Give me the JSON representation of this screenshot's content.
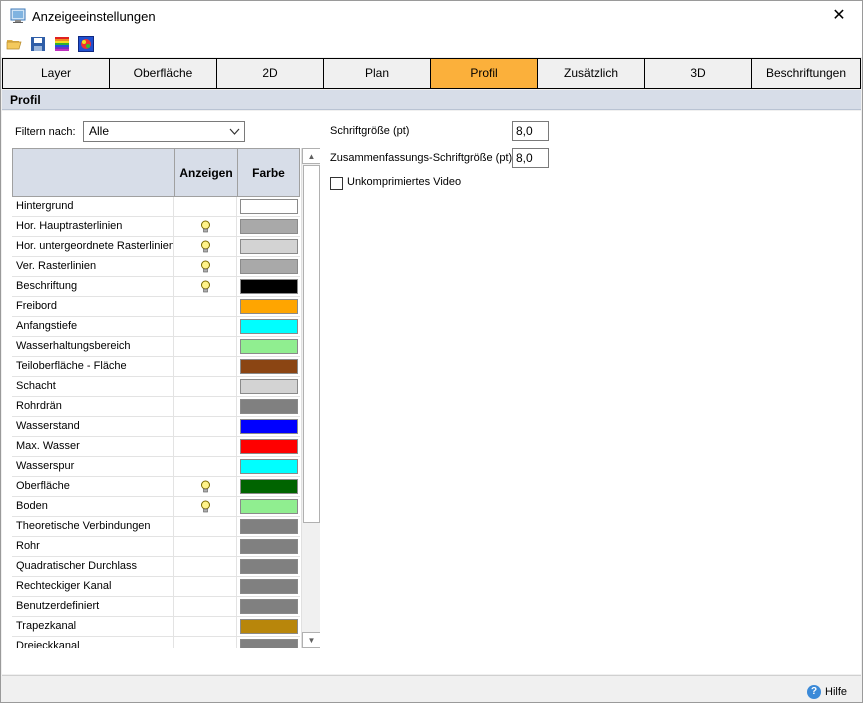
{
  "window": {
    "title": "Anzeigeeinstellungen",
    "close_glyph": "✕"
  },
  "toolbar": {
    "icons": [
      "open-folder-icon",
      "save-icon",
      "color-bars-icon",
      "color-palette-icon"
    ]
  },
  "tabs": [
    {
      "label": "Layer",
      "active": false
    },
    {
      "label": "Oberfläche",
      "active": false
    },
    {
      "label": "2D",
      "active": false
    },
    {
      "label": "Plan",
      "active": false
    },
    {
      "label": "Profil",
      "active": true
    },
    {
      "label": "Zusätzlich",
      "active": false
    },
    {
      "label": "3D",
      "active": false
    },
    {
      "label": "Beschriftungen",
      "active": false
    }
  ],
  "section": {
    "title": "Profil"
  },
  "filter": {
    "label": "Filtern nach:",
    "value": "Alle"
  },
  "grid": {
    "headers": {
      "show": "Anzeigen",
      "color": "Farbe"
    },
    "rows": [
      {
        "name": "Hintergrund",
        "show": false,
        "color": "#ffffff"
      },
      {
        "name": "Hor. Hauptrasterlinien",
        "show": true,
        "color": "#a9a9a9"
      },
      {
        "name": "Hor. untergeordnete Rasterlinien",
        "show": true,
        "color": "#d3d3d3"
      },
      {
        "name": "Ver. Rasterlinien",
        "show": true,
        "color": "#a9a9a9"
      },
      {
        "name": "Beschriftung",
        "show": true,
        "color": "#000000"
      },
      {
        "name": "Freibord",
        "show": false,
        "color": "#ffa500"
      },
      {
        "name": "Anfangstiefe",
        "show": false,
        "color": "#00ffff"
      },
      {
        "name": "Wasserhaltungsbereich",
        "show": false,
        "color": "#90ee90"
      },
      {
        "name": "Teiloberfläche - Fläche",
        "show": false,
        "color": "#8b4513"
      },
      {
        "name": "Schacht",
        "show": false,
        "color": "#d3d3d3"
      },
      {
        "name": "Rohrdrän",
        "show": false,
        "color": "#808080"
      },
      {
        "name": "Wasserstand",
        "show": false,
        "color": "#0000ff"
      },
      {
        "name": "Max. Wasser",
        "show": false,
        "color": "#ff0000"
      },
      {
        "name": "Wasserspur",
        "show": false,
        "color": "#00ffff"
      },
      {
        "name": "Oberfläche",
        "show": true,
        "color": "#006400"
      },
      {
        "name": "Boden",
        "show": true,
        "color": "#90ee90"
      },
      {
        "name": "Theoretische Verbindungen",
        "show": false,
        "color": "#808080"
      },
      {
        "name": "Rohr",
        "show": false,
        "color": "#808080"
      },
      {
        "name": "Quadratischer Durchlass",
        "show": false,
        "color": "#808080"
      },
      {
        "name": "Rechteckiger Kanal",
        "show": false,
        "color": "#808080"
      },
      {
        "name": "Benutzerdefiniert",
        "show": false,
        "color": "#808080"
      },
      {
        "name": "Trapezkanal",
        "show": false,
        "color": "#b8860b"
      },
      {
        "name": "Dreieckkanal",
        "show": false,
        "color": "#808080"
      }
    ]
  },
  "settings": {
    "font_size_label": "Schriftgröße (pt)",
    "font_size_value": "8,0",
    "summary_font_size_label": "Zusammenfassungs-Schriftgröße (pt)",
    "summary_font_size_value": "8,0",
    "uncompressed_video_label": "Unkomprimiertes Video",
    "uncompressed_video_checked": false
  },
  "footer": {
    "help_label": "Hilfe",
    "help_glyph": "?"
  }
}
